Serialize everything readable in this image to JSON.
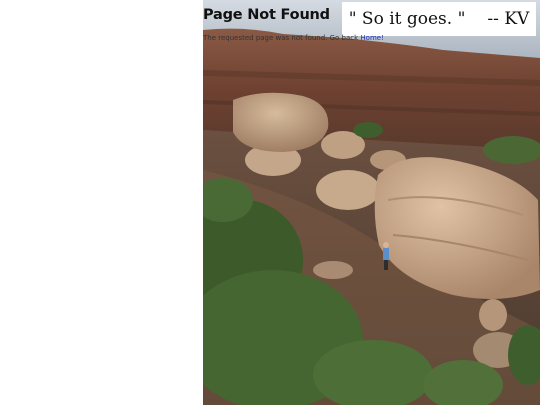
{
  "page": {
    "heading": "Page Not Found",
    "message_prefix": "The requested page was not found. Go back ",
    "home_link": "Home!"
  },
  "quote": {
    "text": "\" So it goes. \"",
    "author": "-- KV"
  },
  "colors": {
    "link": "#1a33cc",
    "sky": "#c9d2dc",
    "cliff": "#7a4a38",
    "rock": "#c9a889",
    "shrub": "#3f5a2c"
  }
}
